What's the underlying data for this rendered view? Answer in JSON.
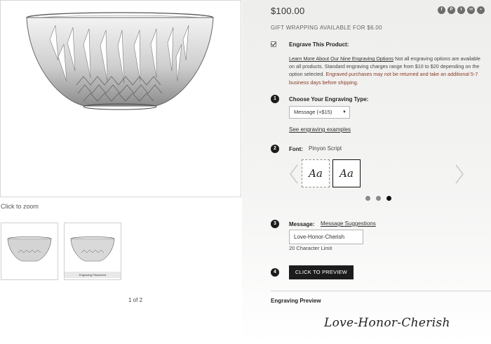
{
  "product": {
    "price": "$100.00",
    "gift_wrap": "GIFT WRAPPING AVAILABLE FOR $6.00"
  },
  "social": [
    {
      "icon": "facebook-icon",
      "glyph": "f"
    },
    {
      "icon": "pinterest-icon",
      "glyph": "P"
    },
    {
      "icon": "twitter-icon",
      "glyph": "t"
    },
    {
      "icon": "email-icon",
      "glyph": "✉"
    },
    {
      "icon": "more-icon",
      "glyph": "•"
    }
  ],
  "gallery": {
    "zoom_hint": "Click to zoom",
    "thumb2_caption": "Engraving Placement",
    "pager": "1 of 2"
  },
  "engrave": {
    "checked": true,
    "title": "Engrave This Product:",
    "learn_link": "Learn More About Our Nine Engraving Options",
    "desc": " Not all engraving options are available on all products. Standard engraving charges range from $10 to $20 depending on the option selected. ",
    "warning": "Engraved purchases may not be returned and take an additional 5-7 business days before shipping."
  },
  "steps": {
    "s1": {
      "num": "1",
      "label": "Choose Your Engraving Type:"
    },
    "s2": {
      "num": "2",
      "label": "Font:"
    },
    "s3": {
      "num": "3",
      "label": "Message:"
    },
    "s4": {
      "num": "4"
    }
  },
  "engraving_type": {
    "selected": "Message (+$15)",
    "caret": "▼",
    "examples_link": "See engraving examples"
  },
  "font": {
    "selected_name": "Pinyon Script",
    "tiles": [
      "Aa",
      "Aa"
    ],
    "carousel_total": 3,
    "carousel_active": 3
  },
  "message": {
    "suggestions_link": "Message Suggestions",
    "value": "Love-Honor-Cherish",
    "limit": "20 Character Limit"
  },
  "preview": {
    "button": "CLICK TO PREVIEW",
    "title": "Engraving Preview",
    "text": "Love-Honor-Cherish"
  },
  "colors": {
    "accent": "#1c1c1c",
    "warning": "#8a3b26",
    "social": "#6d6d6d"
  }
}
